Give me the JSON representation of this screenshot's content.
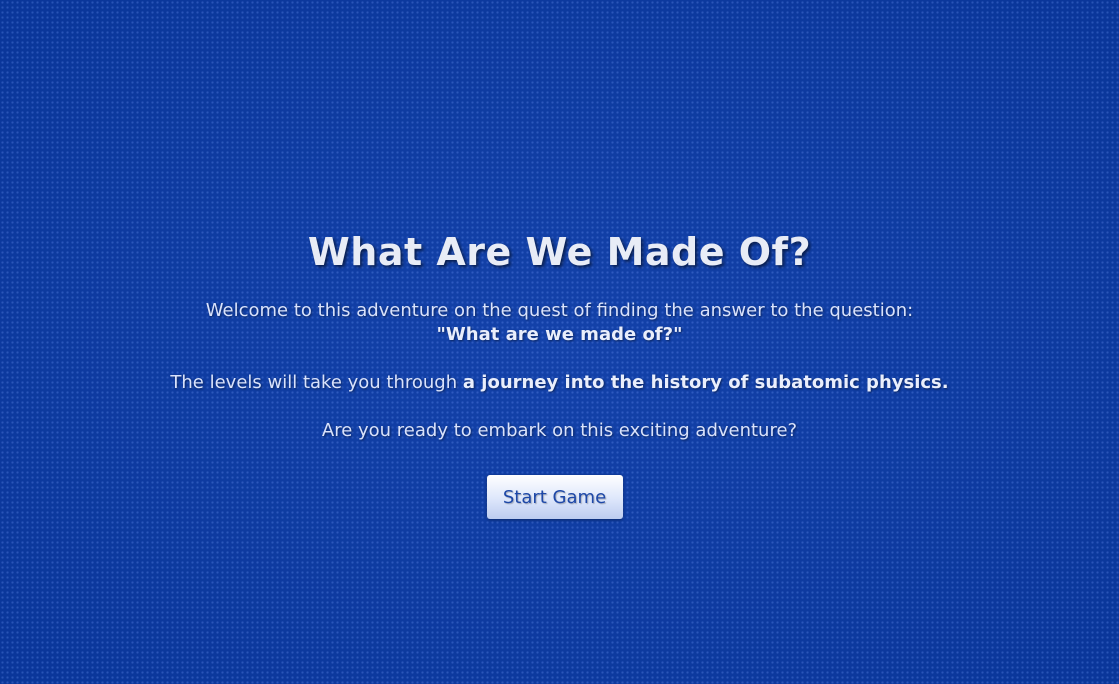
{
  "title": "What Are We Made Of?",
  "intro": {
    "line1": "Welcome to this adventure on the quest of finding the answer to the question:",
    "question": "\"What are we made of?\""
  },
  "levels": {
    "prefix": "The levels will take you through ",
    "emphasis": "a journey into the history of subatomic physics."
  },
  "prompt": "Are you ready to embark on this exciting adventure?",
  "start_button": {
    "label": "Start Game"
  },
  "colors": {
    "background": "#0a3aa6",
    "text": "#e6ecff",
    "button_text": "#1e48a8"
  }
}
